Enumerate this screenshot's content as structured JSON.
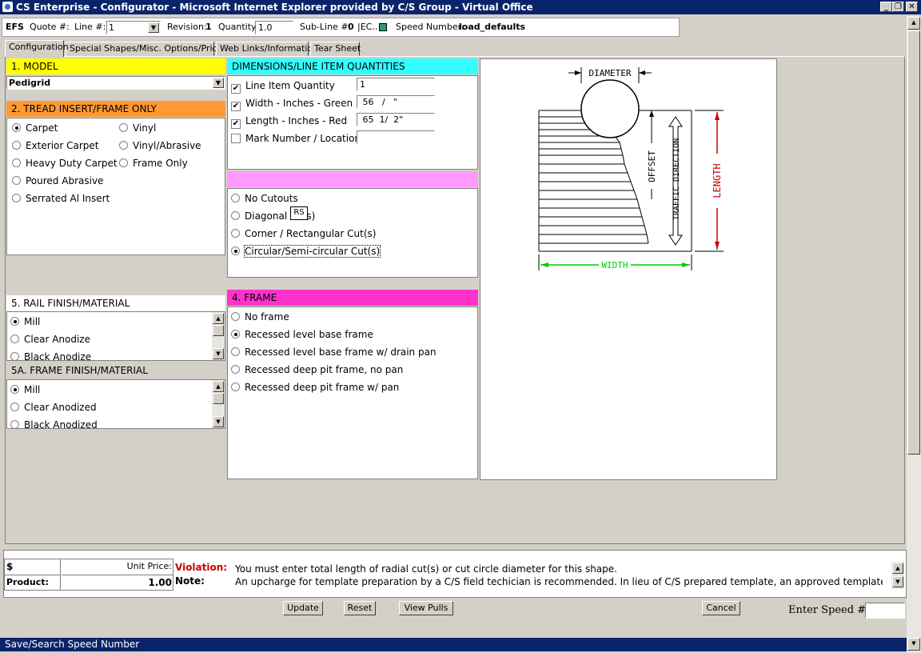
{
  "window": {
    "title": "CS Enterprise - Configurator - Microsoft Internet Explorer provided by C/S Group - Virtual Office",
    "minimize": "_",
    "maximize": "❐",
    "close": "✕"
  },
  "header": {
    "company": "EFS",
    "quote_label": "Quote #:",
    "line_label": "Line #:",
    "line_value": "1",
    "revision_label": "Revision:",
    "revision_value": "1",
    "quantity_label": "Quantity:",
    "quantity_value": "1.0",
    "subline_label": "Sub-Line #:",
    "subline_value": "0",
    "ec_label": "|EC..",
    "speed_label": "Speed Number:",
    "speed_value": "load_defaults"
  },
  "tabs": [
    {
      "label": "Configuration"
    },
    {
      "label": "Special Shapes/Misc. Options/Pricing"
    },
    {
      "label": "Web Links/Information"
    },
    {
      "label": "Tear Sheet"
    }
  ],
  "model": {
    "title": "1. MODEL",
    "value": "Pedigrid",
    "color": "#ffff00"
  },
  "tread": {
    "title": "2. TREAD INSERT/FRAME ONLY",
    "color": "#ff9933",
    "options": [
      {
        "label": "Carpet",
        "selected": true
      },
      {
        "label": "Exterior Carpet",
        "selected": false
      },
      {
        "label": "Heavy Duty Carpet",
        "selected": false
      },
      {
        "label": "Poured Abrasive",
        "selected": false
      },
      {
        "label": "Serrated Al Insert",
        "selected": false
      },
      {
        "label": "Vinyl",
        "selected": false
      },
      {
        "label": "Vinyl/Abrasive",
        "selected": false
      },
      {
        "label": "Frame Only",
        "selected": false
      }
    ]
  },
  "dimensions": {
    "title": "DIMENSIONS/LINE ITEM QUANTITIES",
    "color": "#33ffff",
    "rows": [
      {
        "label": "Line Item Quantity",
        "checked": true,
        "value": "1"
      },
      {
        "label": "Width - Inches - Green",
        "checked": true,
        "value": " 56   /   \""
      },
      {
        "label": "Length - Inches - Red",
        "checked": true,
        "value": " 65  1/  2\""
      },
      {
        "label": "Mark Number / Location",
        "checked": false,
        "value": ""
      }
    ]
  },
  "shapes": {
    "color": "#ff99ff",
    "options": [
      {
        "label": "No Cutouts",
        "selected": false
      },
      {
        "label": "Diagonal C",
        "suffix": "s)",
        "selected": false
      },
      {
        "label": "Corner / Rectangular Cut(s)",
        "selected": false
      },
      {
        "label": "Circular/Semi-circular Cut(s)",
        "selected": true
      }
    ],
    "tooltip": "RS"
  },
  "frame": {
    "title": "4. FRAME",
    "color": "#ff33cc",
    "options": [
      {
        "label": "No frame",
        "selected": false
      },
      {
        "label": "Recessed level base frame",
        "selected": true
      },
      {
        "label": "Recessed level base frame w/ drain pan",
        "selected": false
      },
      {
        "label": "Recessed deep pit frame, no pan",
        "selected": false
      },
      {
        "label": "Recessed deep pit frame w/ pan",
        "selected": false
      }
    ]
  },
  "rail": {
    "title": "5. RAIL FINISH/MATERIAL",
    "options": [
      {
        "label": "Mill",
        "selected": true
      },
      {
        "label": "Clear Anodize",
        "selected": false
      },
      {
        "label": "Black Anodize",
        "selected": false
      }
    ]
  },
  "frame_finish": {
    "title": "5A. FRAME FINISH/MATERIAL",
    "options": [
      {
        "label": "Mill",
        "selected": true
      },
      {
        "label": "Clear Anodized",
        "selected": false
      },
      {
        "label": "Black Anodized",
        "selected": false
      }
    ]
  },
  "diagram": {
    "diameter": "DIAMETER",
    "offset": "OFFSET",
    "traffic": "TRAFFIC DIRECTION",
    "length": "LENGTH",
    "width": "WIDTH",
    "length_color": "#cc0000",
    "width_color": "#00cc00"
  },
  "pricing": {
    "currency": "$",
    "unit_price_label": "Unit Price:",
    "product_label": "Product:",
    "product_value": "1.00"
  },
  "messages": {
    "violation_label": "Violation:",
    "violation_text": "You must enter total length of radial cut(s) or cut circle diameter for this shape.",
    "note_label": "Note:",
    "note_text": "An upcharge for template preparation by a C/S field techician is recommended. In lieu of C/S prepared template, an approved template must"
  },
  "buttons": {
    "update": "Update",
    "reset": "Reset",
    "view_pulls": "View Pulls",
    "cancel": "Cancel"
  },
  "speed_entry": {
    "label": "Enter Speed #:",
    "value": ""
  },
  "status": {
    "text": "Save/Search Speed Number"
  }
}
